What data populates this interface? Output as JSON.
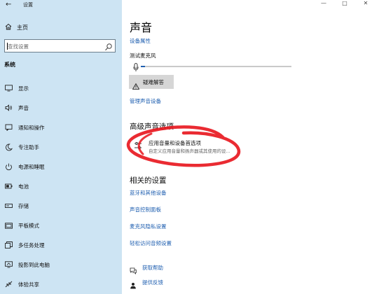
{
  "window": {
    "title": "设置",
    "back_glyph": "←",
    "controls": {
      "minimize": "—",
      "maximize": "□",
      "close": "✕"
    }
  },
  "sidebar": {
    "home_label": "主页",
    "search_placeholder": "查找设置",
    "section": "系统",
    "items": [
      {
        "label": "显示",
        "icon": "monitor-icon"
      },
      {
        "label": "声音",
        "icon": "speaker-icon"
      },
      {
        "label": "通知和操作",
        "icon": "notification-icon"
      },
      {
        "label": "专注助手",
        "icon": "moon-icon"
      },
      {
        "label": "电源和睡眠",
        "icon": "power-icon"
      },
      {
        "label": "电池",
        "icon": "battery-icon"
      },
      {
        "label": "存储",
        "icon": "storage-icon"
      },
      {
        "label": "平板模式",
        "icon": "tablet-icon"
      },
      {
        "label": "多任务处理",
        "icon": "multitask-icon"
      },
      {
        "label": "投影到此电脑",
        "icon": "project-icon"
      },
      {
        "label": "体验共享",
        "icon": "share-icon"
      }
    ]
  },
  "main": {
    "title": "声音",
    "device_properties": "设备属性",
    "test_mic": "测试麦克风",
    "mic_level": 0.03,
    "troubleshoot": "疑难解答",
    "manage_devices": "管理声音设备",
    "advanced_heading": "高级声音选项",
    "app_prefs_title": "应用音量和设备首选项",
    "app_prefs_desc": "自定义应用音量和扬声器或其使用的设...",
    "related_heading": "相关的设置",
    "related_links": [
      "蓝牙和其他设备",
      "声音控制面板",
      "麦克风隐私设置",
      "轻松访问音频设置"
    ],
    "help": "获取帮助",
    "feedback": "提供反馈"
  },
  "colors": {
    "sidebar_bg": "#cde4f3",
    "link": "#1f5fb0",
    "annotation": "#e8141c"
  }
}
